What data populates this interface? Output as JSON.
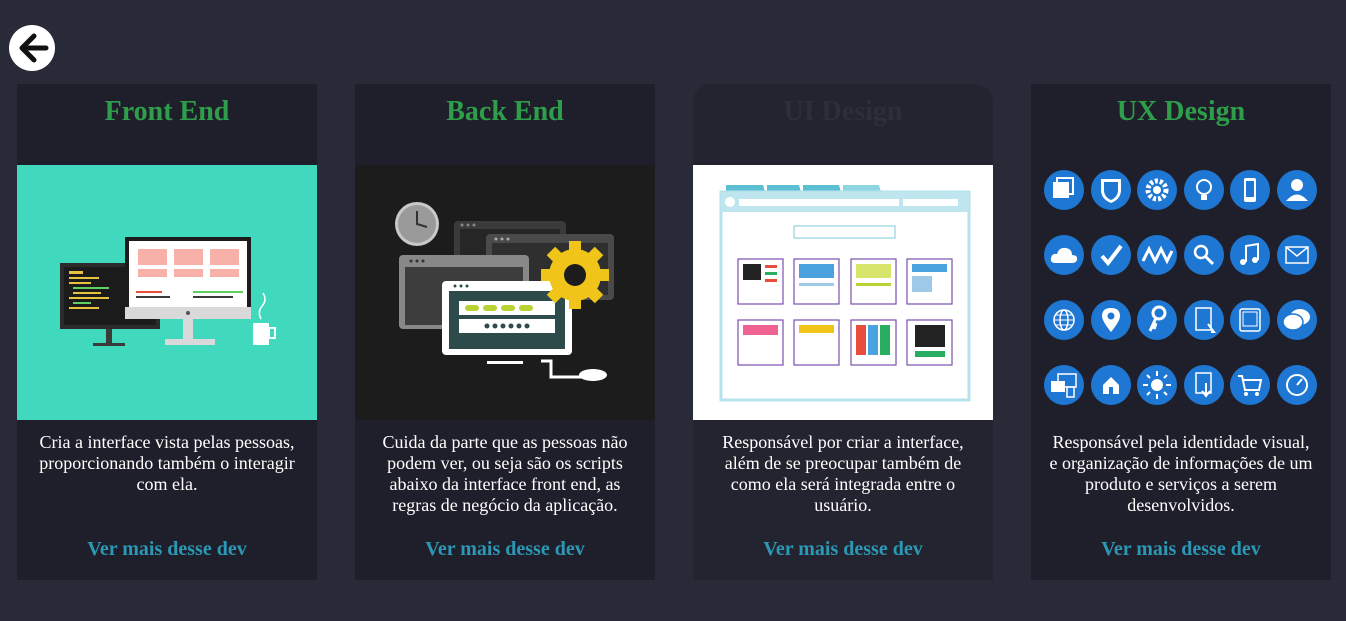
{
  "nav": {
    "back_icon": "arrow-left-icon"
  },
  "cards": [
    {
      "title": "Front End",
      "title_color": "#2e9e4a",
      "description": "Cria a interface vista pelas pessoas, proporcionando também o interagir com ela.",
      "link": "Ver mais desse dev",
      "image_bg": "#40d9bd"
    },
    {
      "title": "Back End",
      "title_color": "#2e9e4a",
      "description": "Cuida da parte que as pessoas não podem ver, ou seja são os scripts abaixo da interface front end, as regras de negócio da aplicação.",
      "link": "Ver mais desse dev",
      "image_bg": "#1c1c1c"
    },
    {
      "title": "UI Design",
      "title_color": "#2e2e38",
      "description": "Responsável por criar a interface, além de se preocupar também de como ela será integrada entre o usuário.",
      "link": "Ver mais desse dev",
      "image_bg": "#ffffff"
    },
    {
      "title": "UX Design",
      "title_color": "#2e9e4a",
      "description": "Responsável pela identidade visual, e organização de informações de um produto e serviços a serem desenvolvidos.",
      "link": "Ver mais desse dev",
      "image_bg": "#1f1f2b"
    }
  ],
  "ux_icons": [
    "windows-icon",
    "shield-icon",
    "gear-icon",
    "lightbulb-icon",
    "phone-icon",
    "user-icon",
    "cloud-icon",
    "check-icon",
    "chevron-logo-icon",
    "search-icon",
    "music-icon",
    "mail-icon",
    "globe-icon",
    "location-pin-icon",
    "key-icon",
    "tablet-touch-icon",
    "tablet-icon",
    "chat-icon",
    "devices-icon",
    "home-icon",
    "sun-icon",
    "download-icon",
    "cart-icon",
    "clock-icon"
  ],
  "colors": {
    "page_bg": "#282a38",
    "card_bg": "#1f1f2b",
    "title_green": "#2e9e4a",
    "link_teal": "#2b98b5",
    "ux_blue": "#1e77d3"
  }
}
